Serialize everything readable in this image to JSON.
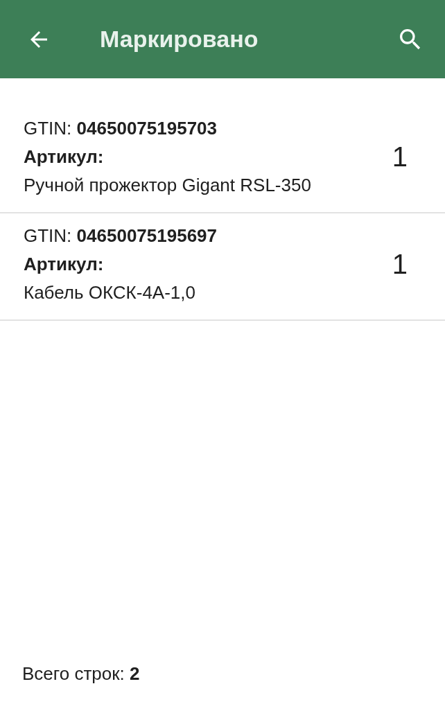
{
  "app_bar": {
    "title": "Маркировано"
  },
  "items": [
    {
      "gtin_label": "GTIN:",
      "gtin": "04650075195703",
      "article_label": "Артикул:",
      "name": "Ручной прожектор Gigant RSL-350",
      "quantity": "1"
    },
    {
      "gtin_label": "GTIN:",
      "gtin": "04650075195697",
      "article_label": "Артикул:",
      "name": "Кабель ОКСК-4А-1,0",
      "quantity": "1"
    }
  ],
  "footer": {
    "label": "Всего строк:",
    "count": "2"
  }
}
